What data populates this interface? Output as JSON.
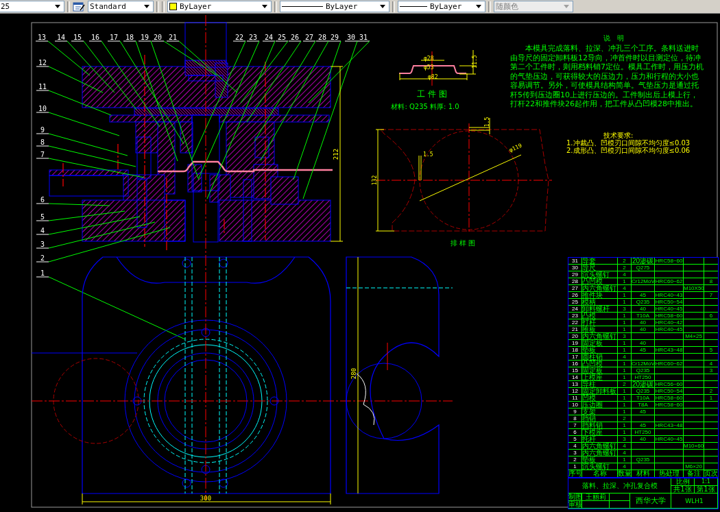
{
  "toolbar": {
    "dim_style": "25",
    "text_style": "Standard",
    "color_setting": "ByLayer",
    "linetype": "ByLayer",
    "lineweight": "ByLayer",
    "plot_style": {
      "value": "随颜色",
      "disabled": true
    }
  },
  "callouts": [
    "13",
    "14",
    "15",
    "16",
    "17",
    "18",
    "19",
    "20",
    "21",
    "22",
    "23",
    "24",
    "25",
    "26",
    "27",
    "28",
    "29",
    "30",
    "31",
    "12",
    "11",
    "10",
    "9",
    "8",
    "7",
    "6",
    "5",
    "4",
    "3",
    "2",
    "1"
  ],
  "main_dimensions": [
    "212",
    "300",
    "280"
  ],
  "workpiece": {
    "dims": [
      "φ28",
      "φ53",
      "φ82",
      "11.5"
    ],
    "title": "工 件 图",
    "material": "材料: Q235  料厚: 1.0"
  },
  "strip_layout": {
    "dims": [
      "1.5",
      "1.5",
      "φ119",
      "132"
    ],
    "title": "排 样 图"
  },
  "notes": {
    "title": "说　明",
    "body": "本模具完成落料、拉深、冲孔三个工序。条料送进时由导尺的固定卸料板12导向，冲首件时以目测定位，待冲第二个工件时，则用档料销7定位。模具工作时，用压力机的气垫压边，可获得较大的压边力，压力和行程的大小也容易调节。另外，可使模具结构简单。气垫压力是通过托杆5传到压边圈10上进行压边的。工件制出后上模上行，打杆22和推件块26起作用，把工件从凸凹模28中推出。"
  },
  "tech_requirements": {
    "title": "技术要求:",
    "items": [
      "1.冲裁凸、凹模刃口间隙不均匀度≤0.03",
      "2.成形凸、凹模刃口间隙不均匀度≤0.06"
    ]
  },
  "parts_table": {
    "rows": [
      {
        "no": "31",
        "name": "导套",
        "qty": "2",
        "material": "20渗碳",
        "heat": "HRC58~60"
      },
      {
        "no": "30",
        "name": "导尺",
        "qty": "2",
        "material": "Q275"
      },
      {
        "no": "29",
        "name": "沉头螺钉",
        "qty": "4"
      },
      {
        "no": "28",
        "name": "凸凹模",
        "qty": "1",
        "material": "Cr12MoV",
        "heat": "HRC60~62",
        "page": "8"
      },
      {
        "no": "27",
        "name": "内六角螺钉",
        "qty": "4",
        "remark": "M10X50"
      },
      {
        "no": "26",
        "name": "推件块",
        "qty": "1",
        "material": "45",
        "heat": "HRC40~43",
        "page": "7"
      },
      {
        "no": "25",
        "name": "模柄",
        "qty": "1",
        "material": "Q235",
        "heat": "HRC50~54"
      },
      {
        "no": "24",
        "name": "卸料螺杆",
        "qty": "3",
        "material": "40",
        "heat": "HRC40~45"
      },
      {
        "no": "23",
        "name": "凸模",
        "qty": "1",
        "material": "T10A",
        "heat": "HRC58~60",
        "page": "6"
      },
      {
        "no": "22",
        "name": "打杆",
        "qty": "1",
        "material": "40",
        "heat": "HRC40~42"
      },
      {
        "no": "21",
        "name": "推板",
        "qty": "1",
        "material": "40",
        "heat": "HRC40~45"
      },
      {
        "no": "20",
        "name": "内六角螺钉",
        "qty": "3",
        "remark": "M4×25"
      },
      {
        "no": "19",
        "name": "固定板",
        "qty": "1",
        "material": "40"
      },
      {
        "no": "18",
        "name": "垫板",
        "qty": "1",
        "material": "45",
        "heat": "HRC43~48",
        "page": "5"
      },
      {
        "no": "17",
        "name": "圆柱销",
        "qty": "4"
      },
      {
        "no": "16",
        "name": "凸凹模",
        "qty": "1",
        "material": "Cr12MoV",
        "heat": "HRC60~62",
        "page": "4"
      },
      {
        "no": "15",
        "name": "固定板",
        "qty": "1",
        "material": "Q235",
        "page": "3"
      },
      {
        "no": "14",
        "name": "上模座",
        "qty": "1",
        "material": "HT250"
      },
      {
        "no": "13",
        "name": "导柱",
        "qty": "2",
        "material": "20渗碳",
        "heat": "HRC56~60"
      },
      {
        "no": "12",
        "name": "固定卸料板",
        "qty": "1",
        "material": "Q235",
        "heat": "HRC50~54",
        "page": "2"
      },
      {
        "no": "11",
        "name": "凹模",
        "qty": "1",
        "material": "T10A",
        "heat": "HRC58~60",
        "page": "1"
      },
      {
        "no": "10",
        "name": "压边圈",
        "qty": "1",
        "material": "T8A",
        "heat": "HRC58~60"
      },
      {
        "no": "9",
        "name": "支架",
        "qty": "1",
        "material": "45"
      },
      {
        "no": "8",
        "name": "挡销",
        "qty": "2"
      },
      {
        "no": "7",
        "name": "挡料销",
        "qty": "1",
        "material": "45",
        "heat": "HRC43~48"
      },
      {
        "no": "6",
        "name": "下模座",
        "qty": "1",
        "material": "HT250"
      },
      {
        "no": "5",
        "name": "托杆",
        "qty": "3",
        "material": "40",
        "heat": "HRC40~45"
      },
      {
        "no": "4",
        "name": "内六角螺钉",
        "qty": "4",
        "remark": "M10×60"
      },
      {
        "no": "3",
        "name": "内六角螺钉",
        "qty": "4"
      },
      {
        "no": "2",
        "name": "垫板",
        "qty": "1",
        "material": "Q235"
      },
      {
        "no": "1",
        "name": "沉头螺钉",
        "qty": "4",
        "remark": "M6×20"
      }
    ],
    "header": [
      "序号",
      "名称",
      "数量",
      "材料",
      "热处理",
      "备注",
      "页次"
    ]
  },
  "title_block": {
    "title": "落料、拉深、冲孔复合模",
    "scale_label": "比例",
    "scale": "1:1",
    "sheets": "共1张",
    "sheet": "第1张",
    "drawn_label": "制图",
    "drawn_by": "王丽莉",
    "checked_label": "审核",
    "school": "西华大学",
    "code": "WLH1"
  }
}
